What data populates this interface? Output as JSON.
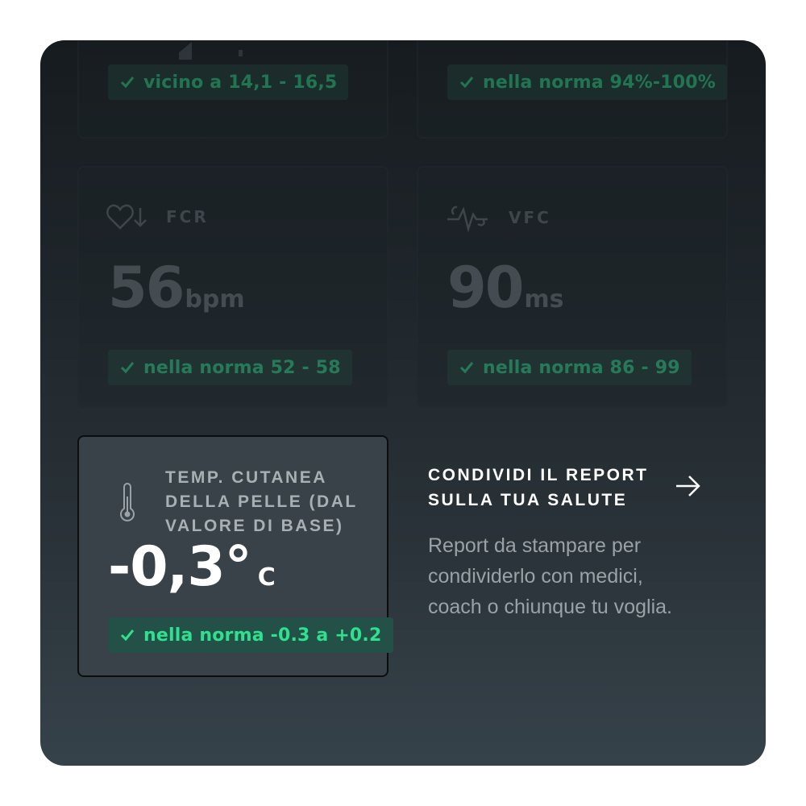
{
  "cards": {
    "top_left": {
      "badge": "vicino a 14,1 - 16,5"
    },
    "top_right": {
      "badge": "nella norma 94%-100%"
    },
    "fcr": {
      "label": "FCR",
      "value": "56",
      "unit": "bpm",
      "badge": "nella norma 52 - 58",
      "icon": "heart-down-icon"
    },
    "vfc": {
      "label": "VFC",
      "value": "90",
      "unit": "ms",
      "badge": "nella norma 86 - 99",
      "icon": "heartbeat-pulse-icon"
    },
    "temp": {
      "label_lines": [
        "TEMP. CUTANEA",
        "DELLA PELLE (DAL",
        "VALORE DI BASE)"
      ],
      "value": "-0,3°",
      "unit": "C",
      "badge": "nella norma -0.3 a +0.2",
      "icon": "thermometer-icon"
    }
  },
  "share": {
    "title_lines": [
      "CONDIVIDI IL REPORT",
      "SULLA TUA SALUTE"
    ],
    "description": "Report da stampare per condividerlo con medici, coach o chiunque tu voglia.",
    "icon": "arrow-right-icon"
  },
  "colors": {
    "accent_green": "#2fe08f",
    "badge_bg": "#245147",
    "panel_top": "#161b1f",
    "panel_bottom": "#36424a"
  }
}
